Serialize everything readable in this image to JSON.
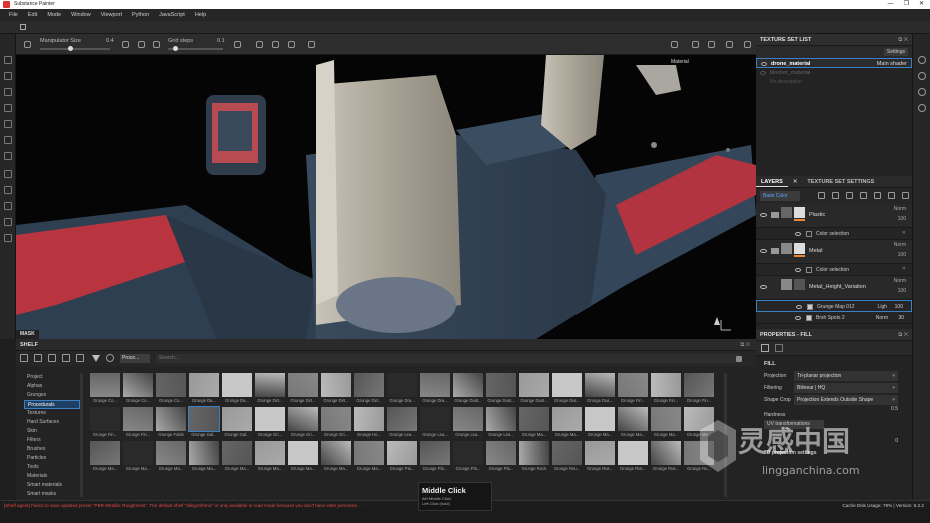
{
  "app": {
    "title": "Substance Painter"
  },
  "window_controls": [
    "—",
    "❐",
    "✕"
  ],
  "menu": [
    "File",
    "Edit",
    "Mode",
    "Window",
    "Viewport",
    "Python",
    "JavaScript",
    "Help"
  ],
  "toolbar": {
    "manipulator_label": "Manipulator Size",
    "manipulator_value": "0.4",
    "grid_label": "Grid steps",
    "grid_value": "0.1",
    "material_mode": "Material"
  },
  "viewport": {
    "mask_label": "MASK"
  },
  "texture_set_list": {
    "title": "TEXTURE SET LIST",
    "settings_label": "Settings",
    "sets": [
      {
        "name": "drone_material",
        "shader": "Main shader",
        "selected": true
      },
      {
        "name": "blocker_material",
        "shader": "",
        "selected": false
      }
    ],
    "no_description": "No description"
  },
  "layers": {
    "tab_layers": "LAYERS",
    "tab_settings": "TEXTURE SET SETTINGS",
    "blend_mode": "Base Color",
    "items": [
      {
        "name": "Plastic",
        "blend": "Norm",
        "opacity": "100"
      },
      {
        "name": "Metal",
        "blend": "Norm",
        "opacity": "100"
      },
      {
        "name": "Metal_Height_Variation",
        "blend": "Norm",
        "opacity": "100"
      }
    ],
    "color_selection": "Color selection",
    "sub_effects": [
      {
        "name": "Grunge Map 012",
        "blend": "Ligh",
        "opacity": "100"
      },
      {
        "name": "Brsh Spots 2",
        "blend": "Norm",
        "opacity": "30"
      }
    ]
  },
  "properties": {
    "title": "PROPERTIES - FILL",
    "section": "FILL",
    "rows": [
      {
        "key": "Projection",
        "value": "Tri-planar projection"
      },
      {
        "key": "Filtering",
        "value": "Bilinear | HQ"
      },
      {
        "key": "Shape Crop",
        "value": "Projection Extends Outside Shape"
      }
    ],
    "hardness_label": "Hardness",
    "hardness_value": "0.5",
    "uv_label": "UV transformations",
    "projection_value": "0",
    "projection_3d": "3D projection settings"
  },
  "shelf": {
    "title": "SHELF",
    "filter_chip": "Proce...",
    "search_placeholder": "Search...",
    "categories": [
      "Project",
      "Alphas",
      "Grunges",
      "Procedurals",
      "Textures",
      "Hard Surfaces",
      "Skin",
      "Filters",
      "Brushes",
      "Particles",
      "Tools",
      "Materials",
      "Smart materials",
      "Smart masks"
    ],
    "selected_category": "Procedurals",
    "tile_labels": [
      "Grunge Co...",
      "Grunge Co...",
      "Grunge Co...",
      "Grunge Da...",
      "Grunge Da...",
      "Grunge Dirt...",
      "Grunge Dirt...",
      "Grunge Dirt...",
      "Grunge Dirt...",
      "Grunge Dra...",
      "Grunge Dra...",
      "Grunge Dust...",
      "Grunge Dust...",
      "Grunge Dust...",
      "Grunge Dus...",
      "Grunge Dus...",
      "Grunge Fin...",
      "Grunge Fin...",
      "Grunge Fin...",
      "Grunge Fin...",
      "Grunge Fin...",
      "Grunge Folds",
      "Grunge Gal...",
      "Grunge Gal...",
      "Grunge Gri...",
      "Grunge Gri...",
      "Grunge Gri...",
      "Grunge Ho...",
      "Grunge Lea...",
      "Grunge Lea...",
      "Grunge Lea...",
      "Grunge Lea...",
      "Grunge Ma...",
      "Grunge Ma...",
      "Grunge Ma...",
      "Grunge Ma...",
      "Grunge Ma...",
      "Grunge Ma...",
      "Grunge Ma...",
      "Grunge Ma...",
      "Grunge Ma...",
      "Grunge Ma...",
      "Grunge Ma...",
      "Grunge Ma...",
      "Grunge Ma...",
      "Grunge Ma...",
      "Grunge Ma...",
      "Grunge Pai...",
      "Grunge Pla...",
      "Grunge Pla...",
      "Grunge Pla...",
      "Grunge Rock",
      "Grunge Rou...",
      "Grunge Rus...",
      "Grunge Rus...",
      "Grunge Rus...",
      "Grunge Ru..."
    ],
    "selected_tile": 22
  },
  "tooltip": {
    "title": "Middle Click",
    "line1": "Alt+Middle Click:",
    "line2": "Left Click (hold)"
  },
  "status": {
    "error": "[Shelf agent] Failed to save updated preset \"PBR Metallic Roughness\". The default shelf \"allegorithmic\" is only available in read mode because you don't have write permissio...",
    "cache": "Cache Disk Usage: 79% | Version: 6.2.2"
  },
  "watermark": {
    "cn": "灵感中国",
    "en": "lingganchina.com"
  }
}
